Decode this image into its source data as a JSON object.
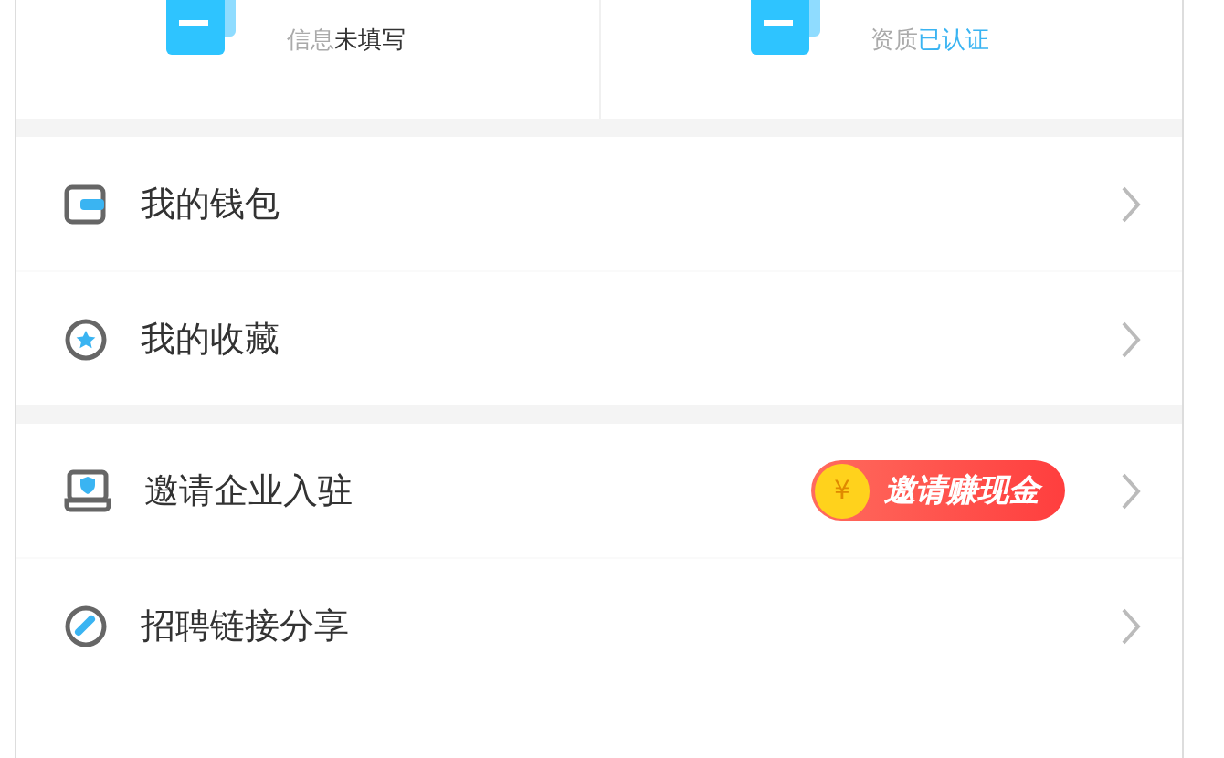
{
  "profile_cards": [
    {
      "label": "信息",
      "status": "未填写",
      "color": "#333333"
    },
    {
      "label": "资质",
      "status": "已认证",
      "color": "#3ab4f2"
    }
  ],
  "menu_groups": [
    {
      "items": [
        {
          "label": "我的钱包"
        },
        {
          "label": "我的收藏"
        }
      ]
    },
    {
      "items": [
        {
          "label": "邀请企业入驻",
          "badge": {
            "coin": "¥",
            "label": "邀请赚现金"
          }
        },
        {
          "label": "招聘链接分享"
        }
      ]
    }
  ]
}
